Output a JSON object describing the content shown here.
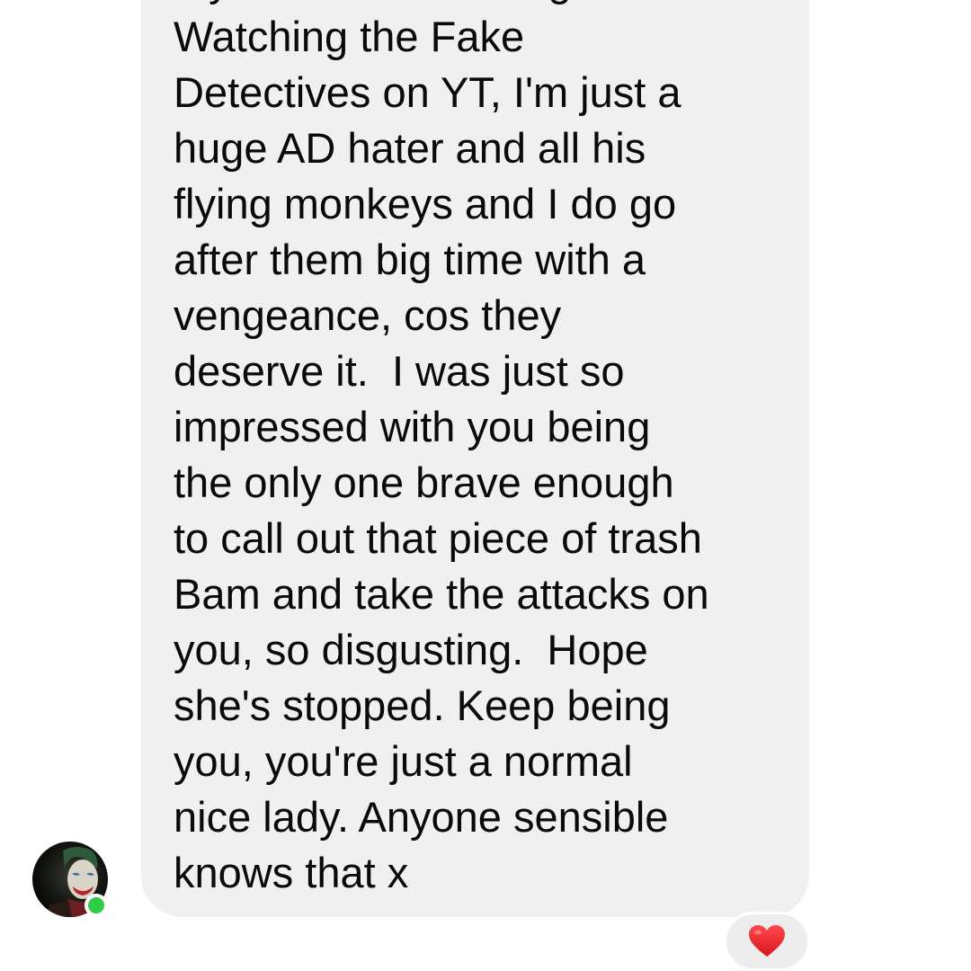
{
  "message": {
    "lines": [
      "my friend who can't get on here.",
      "Watching the Fake",
      "Detectives on YT, I'm just a",
      "huge AD hater and all his",
      "flying monkeys and I do go",
      "after them big time with a",
      "vengeance, cos they",
      "deserve it.  I was just so",
      "impressed with you being",
      "the only one brave enough",
      "to call out that piece of trash",
      "Bam and take the attacks on",
      "you, so disgusting.  Hope",
      "she's stopped. Keep being",
      "you, you're just a normal",
      "nice lady. Anyone sensible",
      "knows that x"
    ]
  },
  "sender": {
    "avatar_icon": "joker-avatar",
    "online": true,
    "online_color": "#31cc46"
  },
  "reaction": {
    "icon": "heart-icon",
    "color": "#e8262b"
  },
  "colors": {
    "bubble": "#f0f0f0",
    "text": "#0a0a0a",
    "background": "#ffffff"
  }
}
